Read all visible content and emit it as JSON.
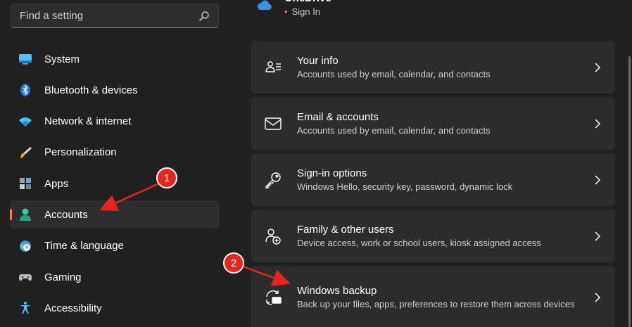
{
  "search": {
    "placeholder": "Find a setting"
  },
  "onedrive": {
    "title": "OneDrive",
    "status": "Sign In"
  },
  "sidebar": {
    "items": [
      {
        "label": "System",
        "icon": "monitor-icon"
      },
      {
        "label": "Bluetooth & devices",
        "icon": "bluetooth-icon"
      },
      {
        "label": "Network & internet",
        "icon": "wifi-icon"
      },
      {
        "label": "Personalization",
        "icon": "brush-icon"
      },
      {
        "label": "Apps",
        "icon": "apps-icon"
      },
      {
        "label": "Accounts",
        "icon": "person-icon",
        "selected": true
      },
      {
        "label": "Time & language",
        "icon": "globe-clock-icon"
      },
      {
        "label": "Gaming",
        "icon": "gamepad-icon"
      },
      {
        "label": "Accessibility",
        "icon": "accessibility-icon"
      }
    ]
  },
  "cards": [
    {
      "title": "Your info",
      "desc": "Accounts used by email, calendar, and contacts",
      "icon": "user-info-icon"
    },
    {
      "title": "Email & accounts",
      "desc": "Accounts used by email, calendar, and contacts",
      "icon": "envelope-icon"
    },
    {
      "title": "Sign-in options",
      "desc": "Windows Hello, security key, password, dynamic lock",
      "icon": "key-icon"
    },
    {
      "title": "Family & other users",
      "desc": "Device access, work or school users, kiosk assigned access",
      "icon": "family-icon"
    },
    {
      "title": "Windows backup",
      "desc": "Back up your files, apps, preferences to restore them across devices",
      "icon": "backup-icon"
    }
  ],
  "annotations": [
    {
      "number": "1"
    },
    {
      "number": "2"
    }
  ],
  "colors": {
    "background": "#202020",
    "card": "#2c2c2c",
    "accent_selected": "#ff7a64",
    "annotation_red": "#e52620"
  }
}
